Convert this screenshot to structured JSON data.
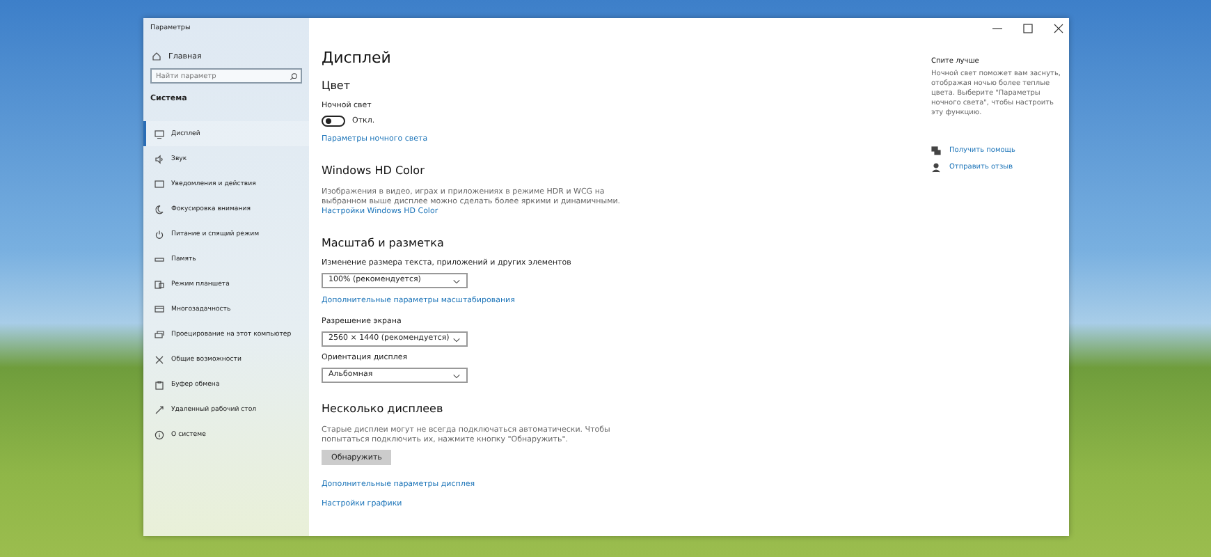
{
  "window": {
    "title": "Параметры"
  },
  "sidebar": {
    "home": {
      "label": "Главная"
    },
    "search": {
      "placeholder": "Найти параметр"
    },
    "section": "Система",
    "items": [
      {
        "label": "Дисплей",
        "selected": true
      },
      {
        "label": "Звук",
        "selected": false
      },
      {
        "label": "Уведомления и действия",
        "selected": false
      },
      {
        "label": "Фокусировка внимания",
        "selected": false
      },
      {
        "label": "Питание и спящий режим",
        "selected": false
      },
      {
        "label": "Память",
        "selected": false
      },
      {
        "label": "Режим планшета",
        "selected": false
      },
      {
        "label": "Многозадачность",
        "selected": false
      },
      {
        "label": "Проецирование на этот компьютер",
        "selected": false
      },
      {
        "label": "Общие возможности",
        "selected": false
      },
      {
        "label": "Буфер обмена",
        "selected": false
      },
      {
        "label": "Удаленный рабочий стол",
        "selected": false
      },
      {
        "label": "О системе",
        "selected": false
      }
    ]
  },
  "main": {
    "blocks": [
      {
        "kind": "title",
        "text": "Дисплей"
      },
      {
        "kind": "heading",
        "text": "Цвет"
      },
      {
        "kind": "label",
        "text": "Ночной свет"
      },
      {
        "kind": "toggle",
        "on": false,
        "text": "Откл."
      },
      {
        "kind": "link",
        "text": "Параметры ночного света"
      },
      {
        "kind": "heading",
        "text": "Windows HD Color"
      },
      {
        "kind": "paragraph",
        "text": "Изображения в видео, играх и приложениях в режиме HDR и WCG на выбранном выше дисплее можно сделать более яркими и динамичными."
      },
      {
        "kind": "link",
        "text": "Настройки Windows HD Color"
      },
      {
        "kind": "heading",
        "text": "Масштаб и разметка"
      },
      {
        "kind": "label",
        "text": "Изменение размера текста, приложений и других элементов"
      },
      {
        "kind": "dropdown",
        "text": "100% (рекомендуется)"
      },
      {
        "kind": "link",
        "text": "Дополнительные параметры масштабирования"
      },
      {
        "kind": "label",
        "text": "Разрешение экрана"
      },
      {
        "kind": "dropdown",
        "text": "2560 × 1440 (рекомендуется)"
      },
      {
        "kind": "label",
        "text": "Ориентация дисплея"
      },
      {
        "kind": "dropdown",
        "text": "Альбомная"
      },
      {
        "kind": "heading",
        "text": "Несколько дисплеев"
      },
      {
        "kind": "paragraph",
        "text": "Старые дисплеи могут не всегда подключаться автоматически. Чтобы попытаться подключить их, нажмите кнопку \"Обнаружить\"."
      },
      {
        "kind": "button",
        "text": "Обнаружить"
      },
      {
        "kind": "link",
        "text": "Дополнительные параметры дисплея"
      },
      {
        "kind": "link",
        "text": "Настройки графики"
      }
    ]
  },
  "aside": {
    "title": "Спите лучше",
    "text": "Ночной свет поможет вам заснуть, отображая ночью более теплые цвета. Выберите \"Параметры ночного света\", чтобы настроить эту функцию.",
    "links": [
      {
        "kind": "help",
        "label": "Получить помощь"
      },
      {
        "kind": "feedback",
        "label": "Отправить отзыв"
      }
    ]
  }
}
